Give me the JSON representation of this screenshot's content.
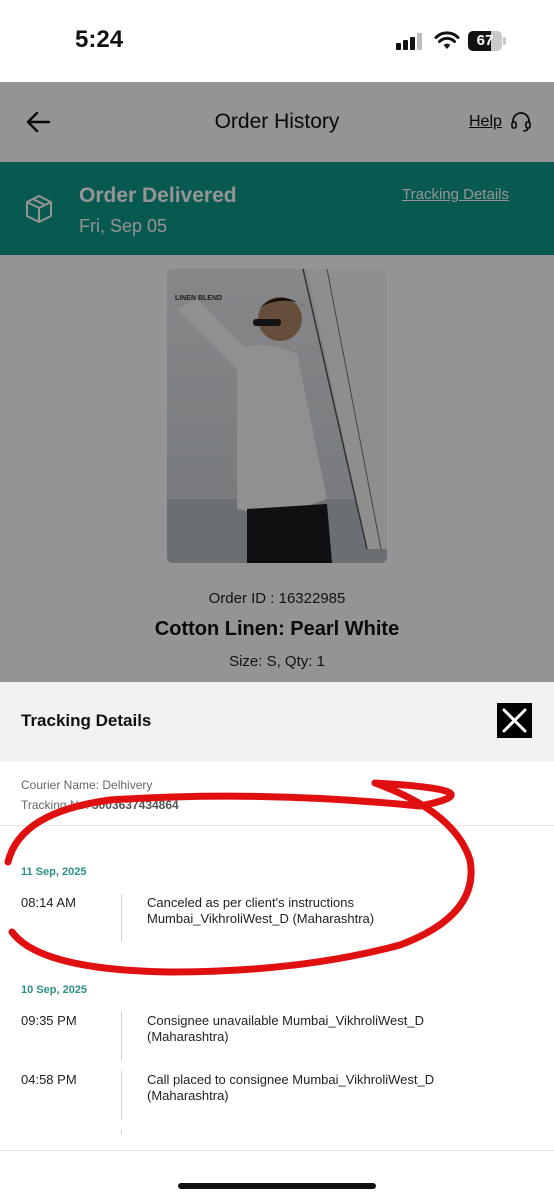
{
  "status_bar": {
    "time": "5:24",
    "battery": "67",
    "battery_level": 0.67
  },
  "header": {
    "title": "Order History",
    "help_label": "Help"
  },
  "banner": {
    "title": "Order Delivered",
    "date": "Fri, Sep 05",
    "tracking_link": "Tracking Details"
  },
  "product": {
    "image_caption": "LINEN BLEND",
    "order_id": "Order ID : 16322985",
    "name": "Cotton Linen: Pearl White",
    "size_qty": "Size: S, Qty: 1"
  },
  "tracking": {
    "title": "Tracking Details",
    "courier": "Courier Name: Delhivery",
    "tracking_no_label": "Tracking No:",
    "tracking_no": "5003637434864",
    "days": [
      {
        "date": "11 Sep, 2025",
        "events": [
          {
            "time": "08:14 AM",
            "desc": "Canceled as per client's instructions Mumbai_VikhroliWest_D (Maharashtra)"
          }
        ]
      },
      {
        "date": "10 Sep, 2025",
        "events": [
          {
            "time": "09:35 PM",
            "desc": "Consignee unavailable Mumbai_VikhroliWest_D (Maharashtra)"
          },
          {
            "time": "04:58 PM",
            "desc": "Call placed to consignee Mumbai_VikhroliWest_D (Maharashtra)"
          }
        ]
      }
    ]
  },
  "colors": {
    "brand_green": "#0f9a88",
    "date_teal": "#2a8f86",
    "annotation_red": "#e01010"
  }
}
